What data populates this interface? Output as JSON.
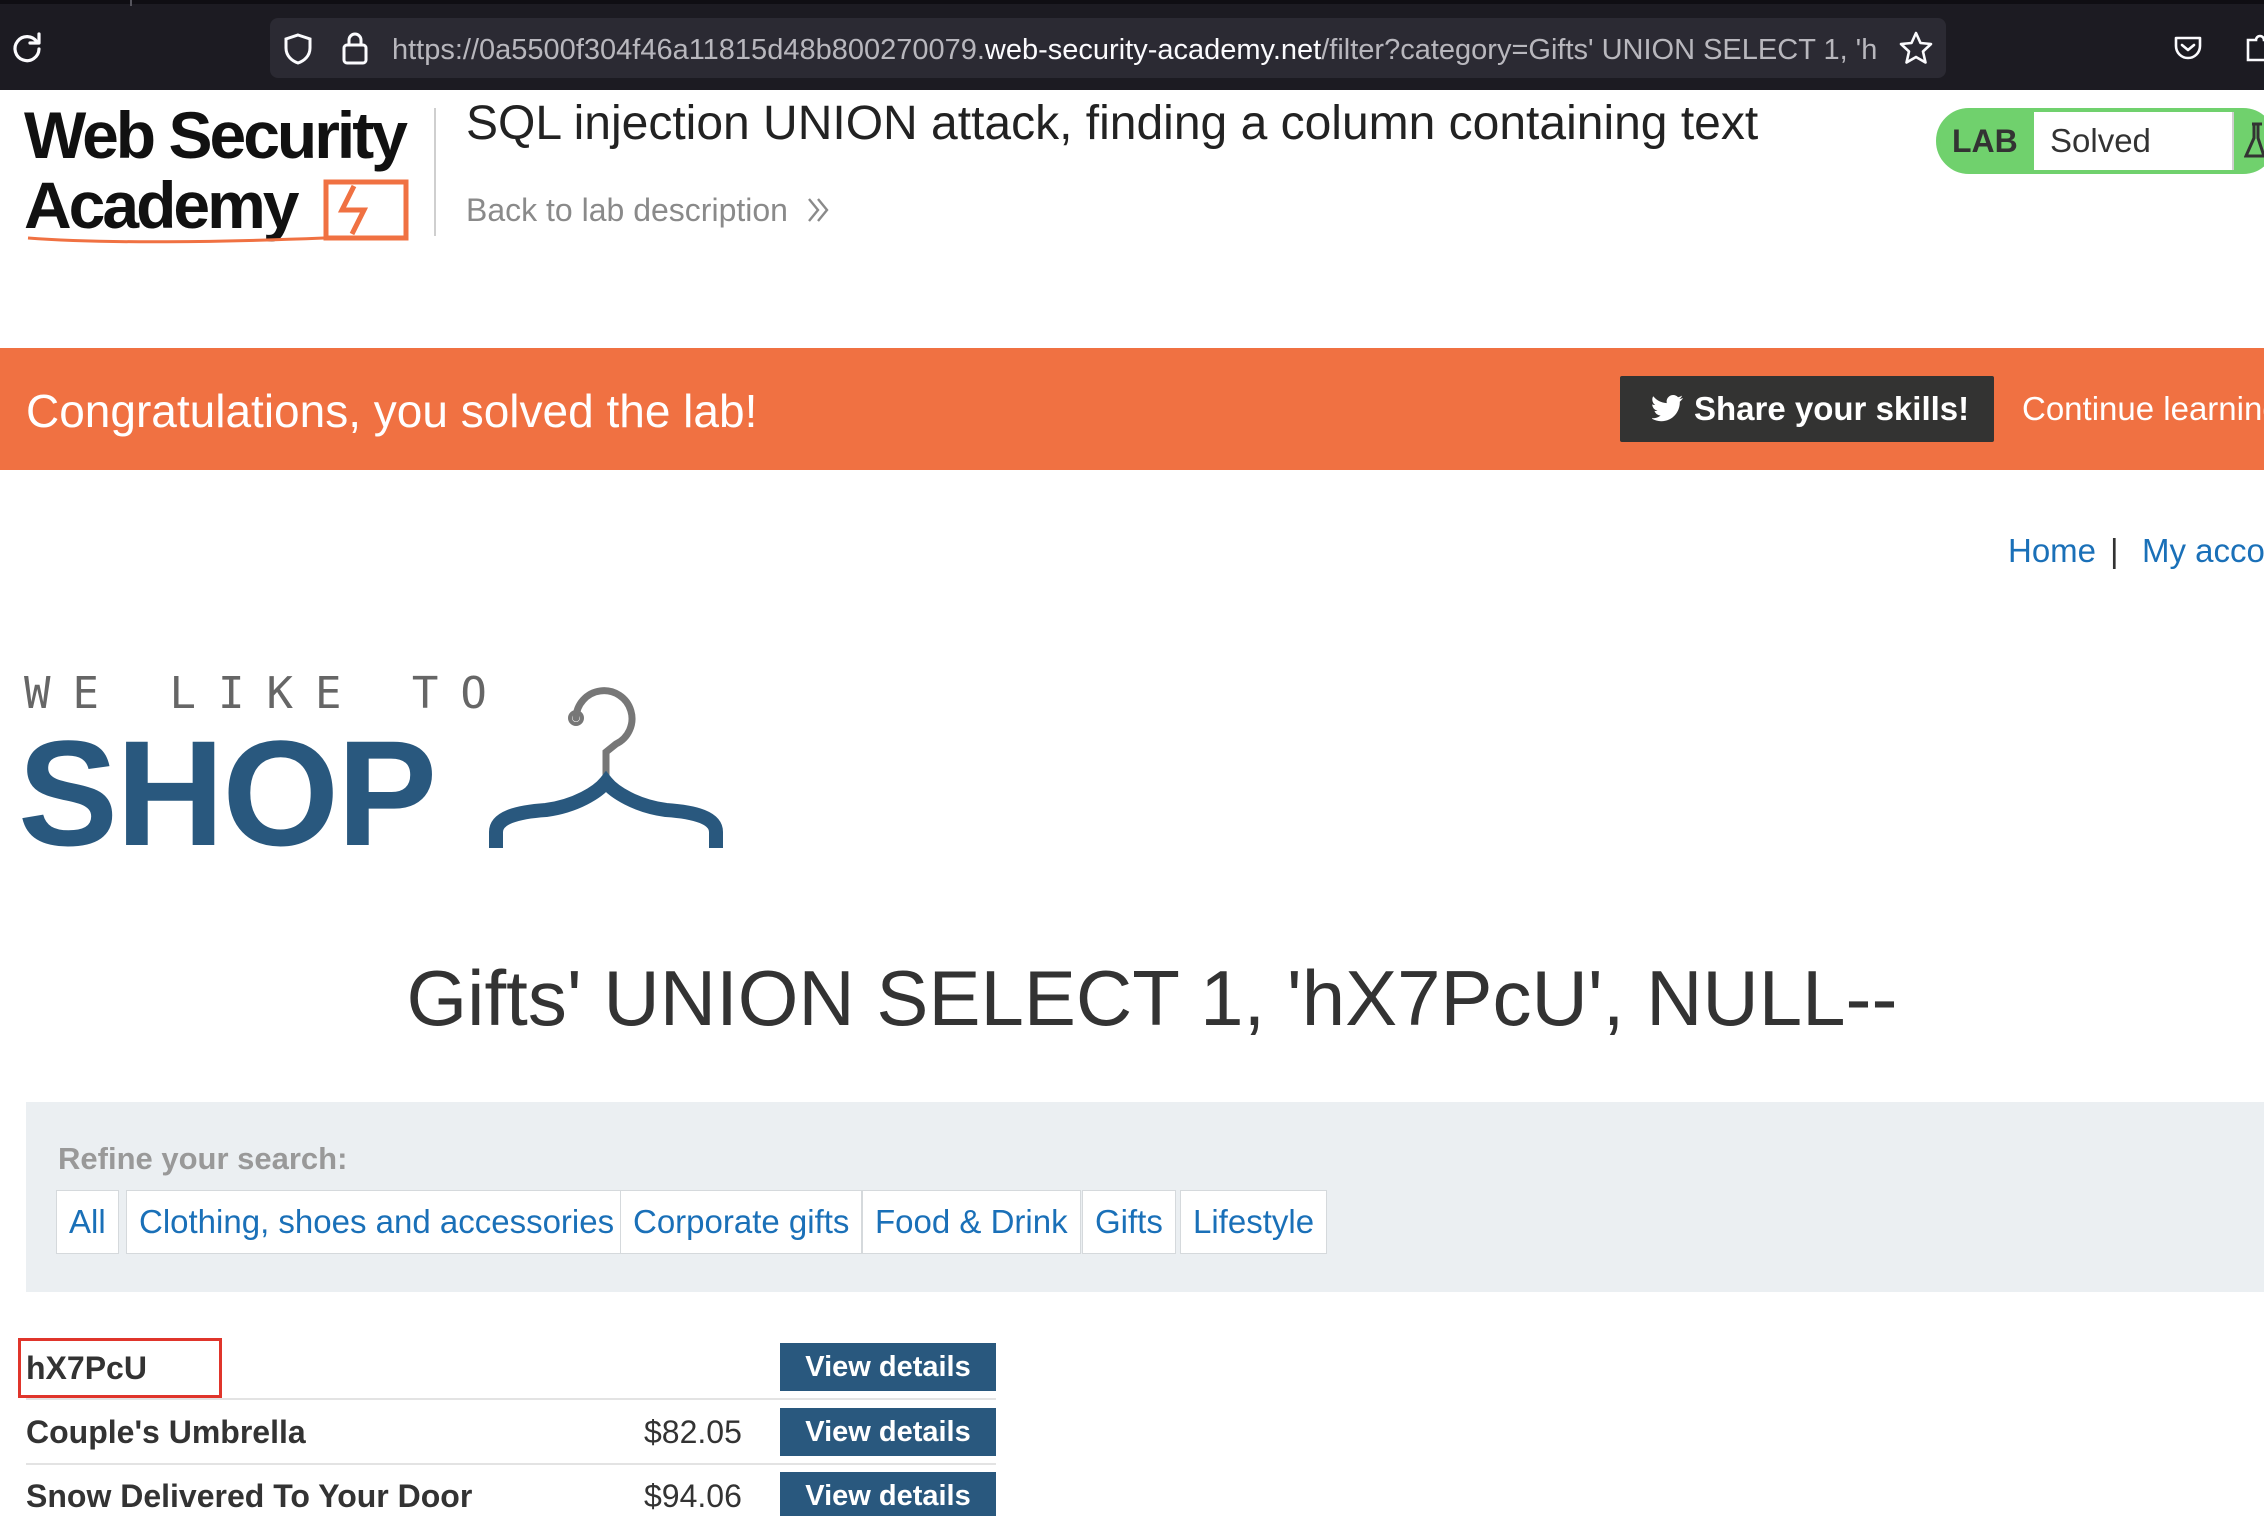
{
  "browser": {
    "url_prefix": "https://0a5500f304f46a11815d48b800270079.",
    "url_domain": "web-security-academy.net",
    "url_path": "/filter?category=Gifts' UNION SELECT 1, 'h",
    "icons": [
      "reload-icon",
      "shield-icon",
      "lock-icon",
      "bookmark-star-icon",
      "pocket-icon",
      "extension-icon"
    ]
  },
  "academy": {
    "logo_line1": "Web Security",
    "logo_line2": "Academy",
    "lab_title": "SQL injection UNION attack, finding a column containing text",
    "back_link": "Back to lab description",
    "status_tag": "LAB",
    "status_value": "Solved",
    "status_color": "#70d16d"
  },
  "banner": {
    "message": "Congratulations, you solved the lab!",
    "share_label": "Share your skills!",
    "continue_label": "Continue learning",
    "color": "#f07142"
  },
  "shop": {
    "nav": {
      "home": "Home",
      "separator": "|",
      "account": "My account"
    },
    "tagline": "WE LIKE TO",
    "brand": "SHOP",
    "category_heading": "Gifts' UNION SELECT 1, 'hX7PcU', NULL--",
    "refine_label": "Refine your search:",
    "filters": [
      "All",
      "Clothing, shoes and accessories",
      "Corporate gifts",
      "Food & Drink",
      "Gifts",
      "Lifestyle"
    ],
    "products": [
      {
        "name": "hX7PcU",
        "price": "",
        "button": "View details",
        "highlighted": true
      },
      {
        "name": "Couple's Umbrella",
        "price": "$82.05",
        "button": "View details",
        "highlighted": false
      },
      {
        "name": "Snow Delivered To Your Door",
        "price": "$94.06",
        "button": "View details",
        "highlighted": false
      }
    ],
    "accent_color": "#29587e",
    "link_color": "#1a70b8"
  }
}
